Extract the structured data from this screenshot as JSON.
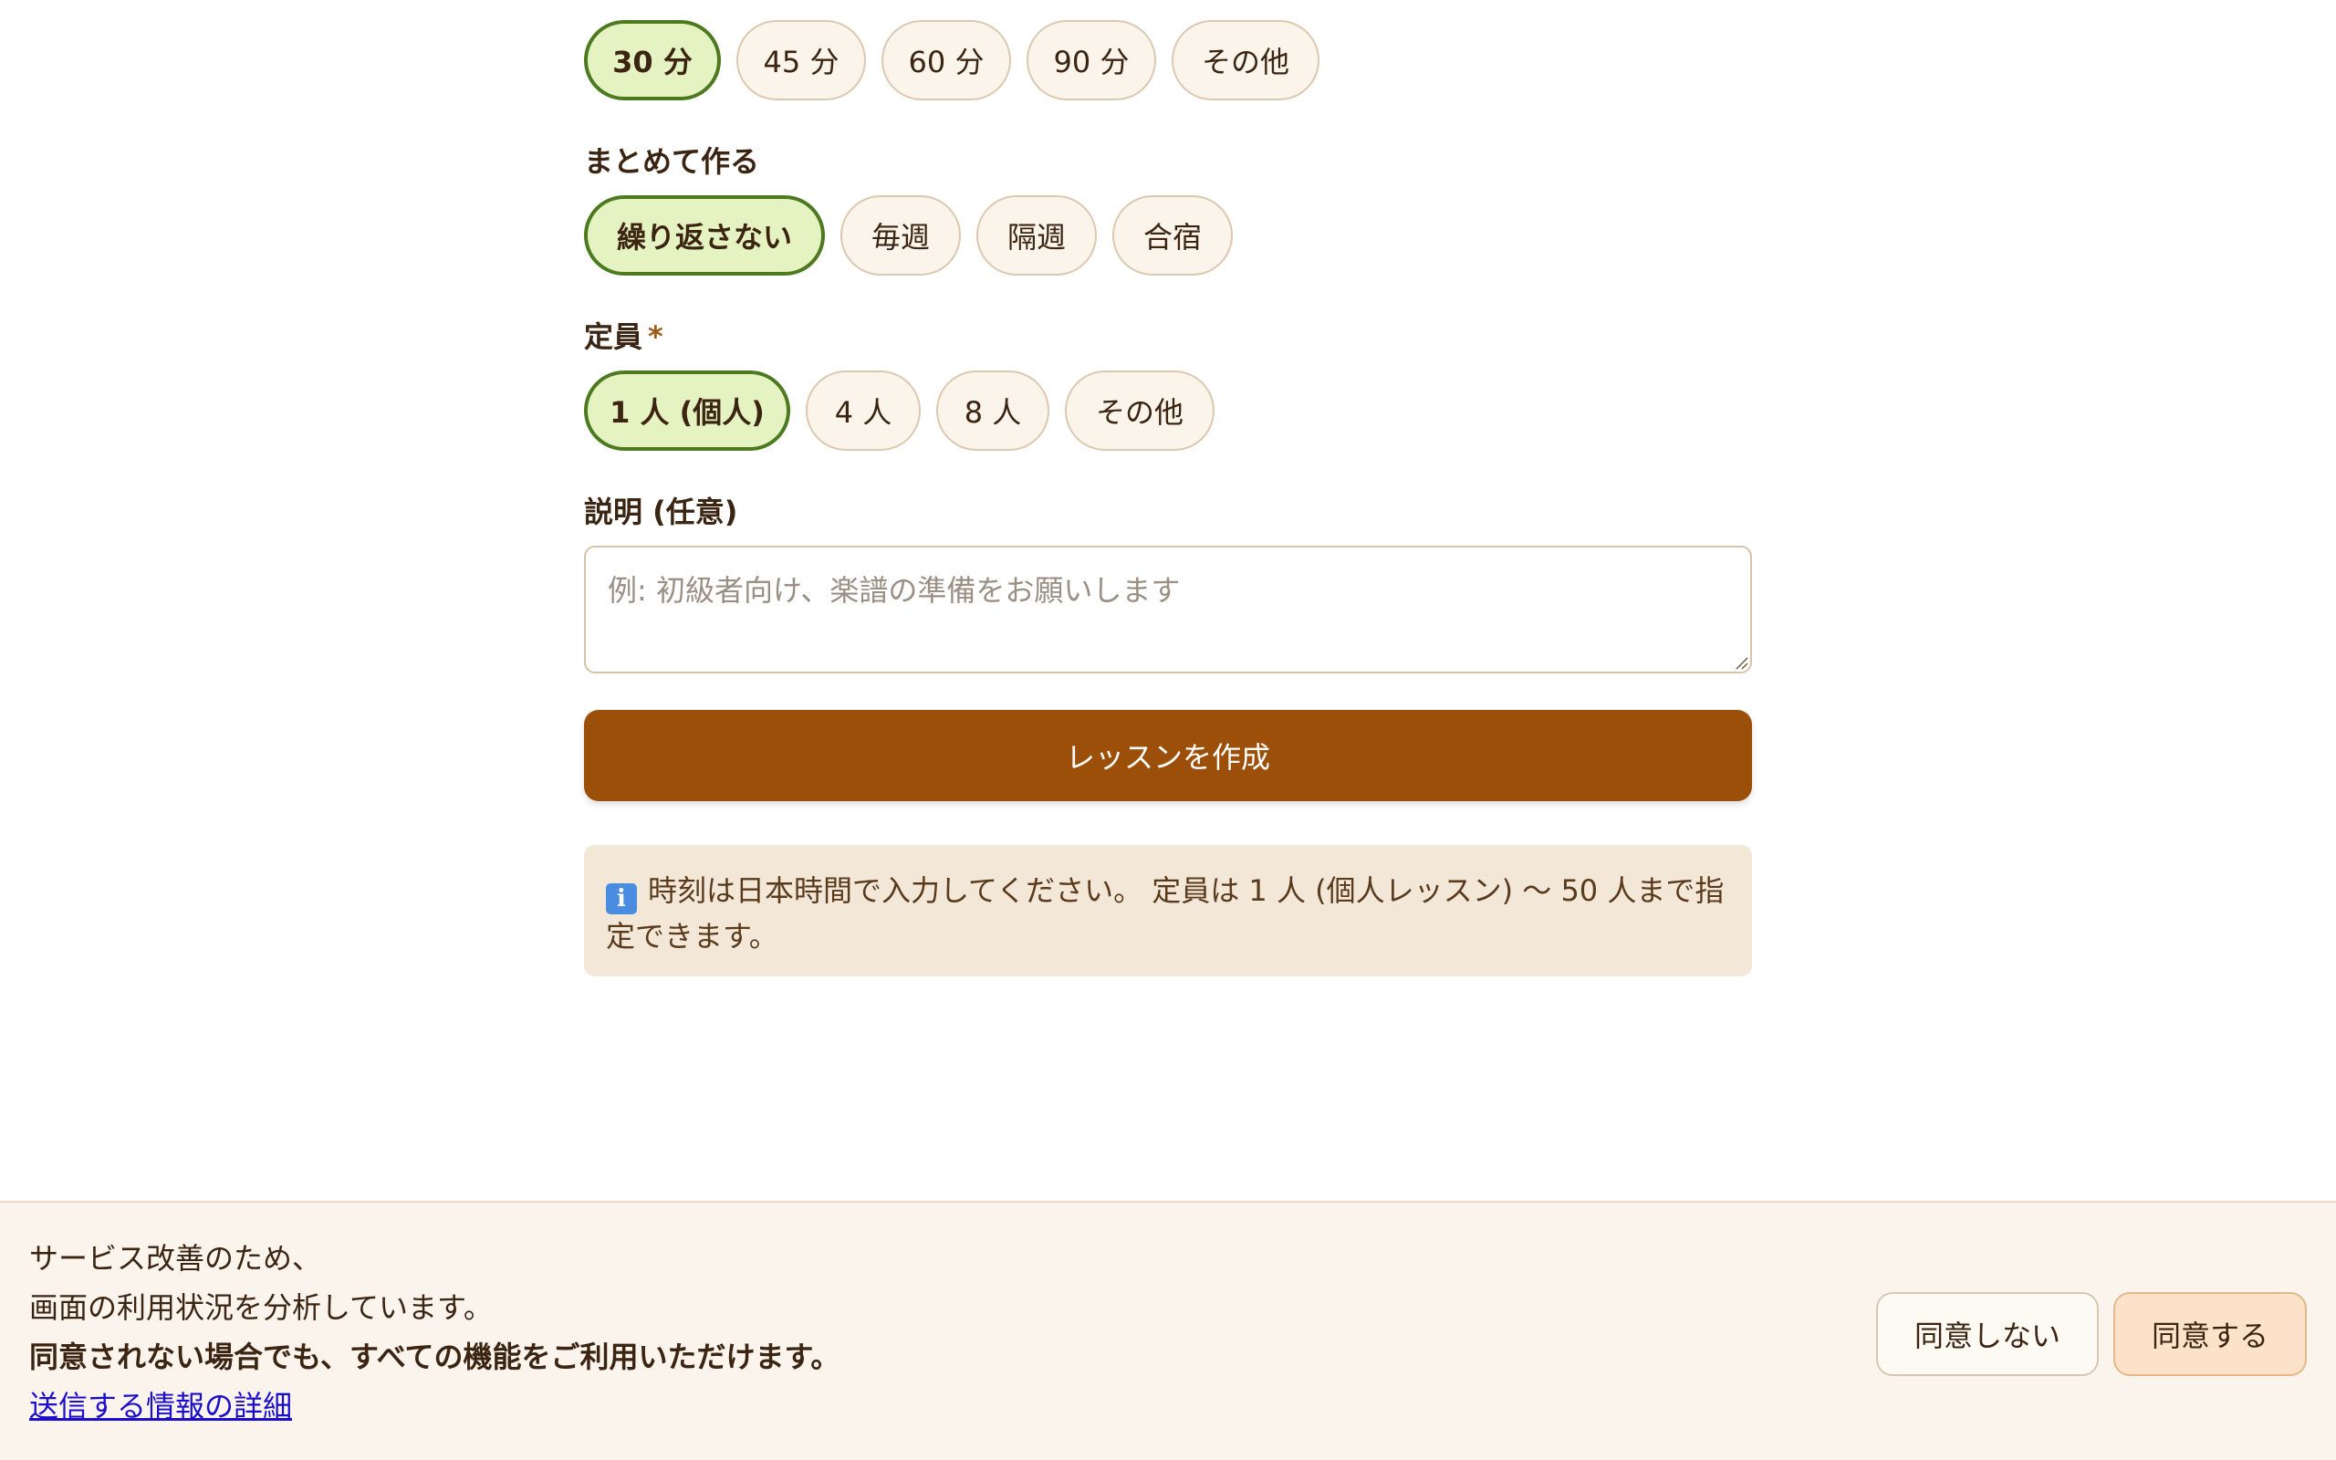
{
  "duration": {
    "options": [
      "30 分",
      "45 分",
      "60 分",
      "90 分",
      "その他"
    ],
    "selected": "30 分"
  },
  "repeat": {
    "label": "まとめて作る",
    "options": [
      "繰り返さない",
      "毎週",
      "隔週",
      "合宿"
    ],
    "selected": "繰り返さない"
  },
  "capacity": {
    "label": "定員",
    "required_mark": "*",
    "options": [
      "1 人 (個人)",
      "4 人",
      "8 人",
      "その他"
    ],
    "selected": "1 人 (個人)"
  },
  "description": {
    "label": "説明 (任意)",
    "placeholder": "例: 初級者向け、楽譜の準備をお願いします",
    "value": ""
  },
  "submit": {
    "label": "レッスンを作成"
  },
  "notice": {
    "icon": "info-icon",
    "icon_glyph": "i",
    "text": "時刻は日本時間で入力してください。 定員は 1 人 (個人レッスン) 〜 50 人まで指定できます。"
  },
  "consent_banner": {
    "line1": "サービス改善のため、",
    "line2": "画面の利用状況を分析しています。",
    "line3": "同意されない場合でも、すべての機能をご利用いただけます。",
    "details_link": "送信する情報の詳細",
    "decline_label": "同意しない",
    "accept_label": "同意する"
  },
  "colors": {
    "accent": "#9c4f08",
    "selected_chip_bg": "#e5f3c3",
    "selected_chip_border": "#4d7a1f",
    "chip_bg": "#faf4ea",
    "notice_bg": "#f3e7d8",
    "info_icon": "#4a8de0",
    "link": "#1a0dcc"
  }
}
